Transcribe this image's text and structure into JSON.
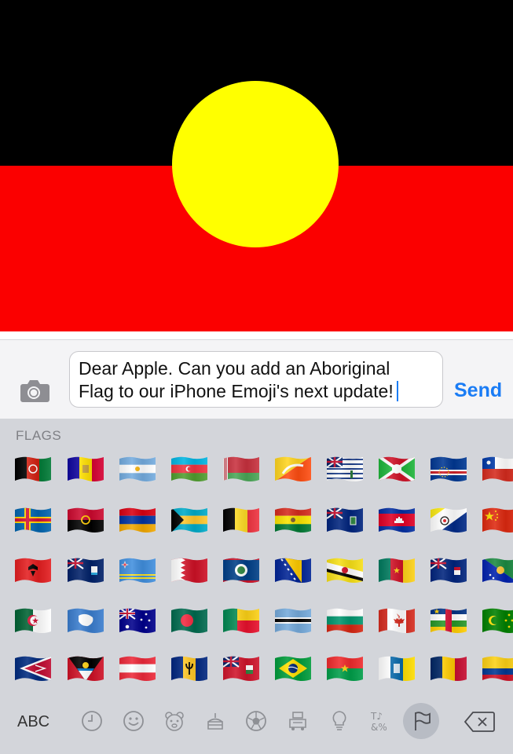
{
  "message": {
    "line1": "Dear Apple. Can you add an Aboriginal",
    "line2": "Flag to our iPhone Emoji's next update!",
    "send_label": "Send"
  },
  "keyboard": {
    "section_title": "FLAGS",
    "abc_label": "ABC",
    "categories": [
      "recent",
      "smileys",
      "animals",
      "food",
      "activity",
      "travel",
      "objects",
      "symbols",
      "flags"
    ],
    "active_category": "flags",
    "symbols_glyph": "T♪ &%"
  },
  "flags": [
    "afghanistan",
    "andorra",
    "argentina",
    "azerbaijan",
    "belarus",
    "bhutan",
    "british-indian-ocean-territory",
    "burundi",
    "cape-verde",
    "chile",
    "aland-islands",
    "angola",
    "armenia",
    "bahamas",
    "belgium",
    "bolivia",
    "british-virgin-islands",
    "cambodia",
    "caribbean-netherlands",
    "china",
    "albania",
    "anguilla",
    "aruba",
    "bahrain",
    "belize",
    "bosnia",
    "brunei",
    "cameroon",
    "cayman-islands",
    "christmas-island",
    "algeria",
    "antarctica",
    "australia",
    "bangladesh",
    "benin",
    "botswana",
    "bulgaria",
    "canada",
    "central-african-republic",
    "cocos-islands",
    "american-samoa",
    "antigua-barbuda",
    "austria",
    "barbados",
    "bermuda",
    "brazil",
    "burkina-faso",
    "canary-islands",
    "chad",
    "colombia"
  ],
  "colors": {
    "flag_black": "#000000",
    "flag_red": "#fb0000",
    "flag_yellow": "#ffff00",
    "accent": "#1a7cf5",
    "keyboard_bg": "#d3d5da"
  }
}
